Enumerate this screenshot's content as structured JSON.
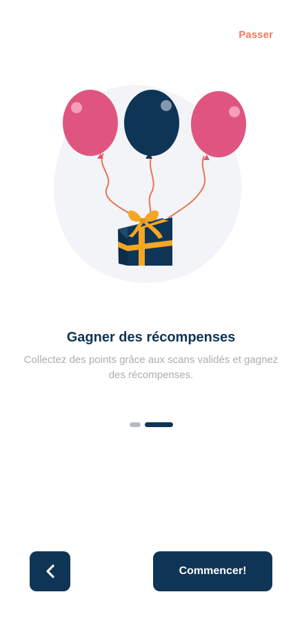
{
  "header": {
    "skip_label": "Passer"
  },
  "illustration": {
    "icon": "balloons-gift-illustration",
    "colors": {
      "balloon_pink": "#e0557f",
      "balloon_navy": "#0f3556",
      "ribbon": "#f5a623",
      "string": "#e8734f",
      "backdrop": "#f2f4f7"
    }
  },
  "content": {
    "title": "Gagner des récompenses",
    "description": "Collectez des points grâce aux scans validés et gagnez des récompenses."
  },
  "pager": {
    "page_count": 2,
    "current_page": 2
  },
  "footer": {
    "back_icon": "chevron-left-icon",
    "start_label": "Commencer!"
  },
  "colors": {
    "primary": "#0f3556",
    "accent": "#f07a5c",
    "muted_text": "#a9adb3",
    "inactive_dot": "#b7bcc3"
  }
}
